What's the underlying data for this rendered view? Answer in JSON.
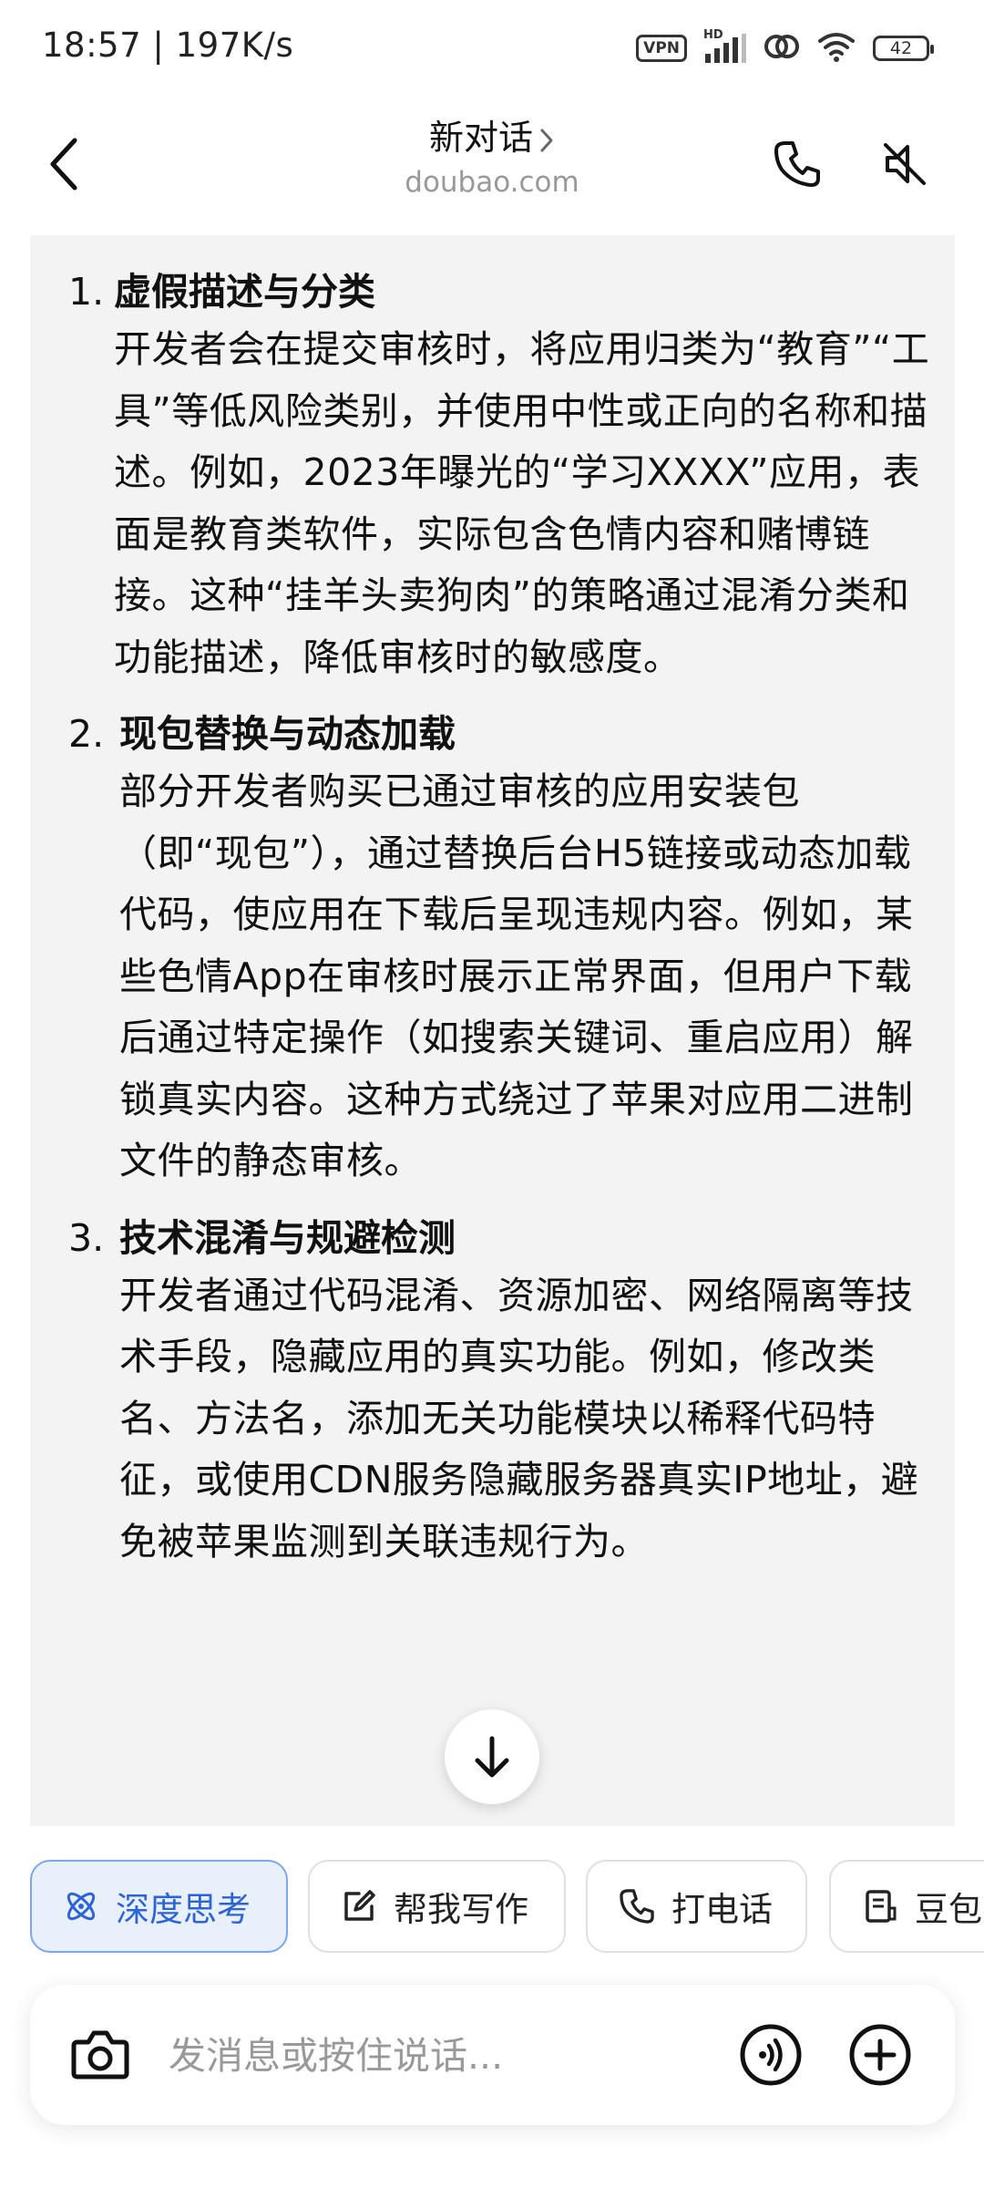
{
  "status_bar": {
    "time_speed": "18:57 | 197K/s",
    "vpn_label": "VPN",
    "network_label": "HD",
    "battery_level": "42"
  },
  "header": {
    "title": "新对话",
    "subtitle": "doubao.com"
  },
  "message": {
    "items": [
      {
        "number": "1.",
        "heading": "虚假描述与分类",
        "body": "开发者会在提交审核时，将应用归类为“教育”“工具”等低风险类别，并使用中性或正向的名称和描述。例如，2023年曝光的“学习XXXX”应用，表面是教育类软件，实际包含色情内容和赌博链接。这种“挂羊头卖狗肉”的策略通过混淆分类和功能描述，降低审核时的敏感度。"
      },
      {
        "number": "2.",
        "heading": "现包替换与动态加载",
        "body": "部分开发者购买已通过审核的应用安装包（即“现包”），通过替换后台H5链接或动态加载代码，使应用在下载后呈现违规内容。例如，某些色情App在审核时展示正常界面，但用户下载后通过特定操作（如搜索关键词、重启应用）解锁真实内容。这种方式绕过了苹果对应用二进制文件的静态审核。"
      },
      {
        "number": "3.",
        "heading": "技术混淆与规避检测",
        "body": "开发者通过代码混淆、资源加密、网络隔离等技术手段，隐藏应用的真实功能。例如，修改类名、方法名，添加无关功能模块以稀释代码特征，或使用CDN服务隐藏服务器真实IP地址，避免被苹果监测到关联违规行为。"
      }
    ]
  },
  "chips": [
    {
      "label": "深度思考",
      "icon": "atom-icon",
      "active": true
    },
    {
      "label": "帮我写作",
      "icon": "edit-icon",
      "active": false
    },
    {
      "label": "打电话",
      "icon": "phone-icon",
      "active": false
    },
    {
      "label": "豆包",
      "icon": "document-icon",
      "active": false
    }
  ],
  "input": {
    "placeholder": "发消息或按住说话..."
  },
  "colors": {
    "accent": "#2c63d8",
    "card_bg": "#f3f3f3",
    "chip_active_bg": "#e8f0fc"
  }
}
